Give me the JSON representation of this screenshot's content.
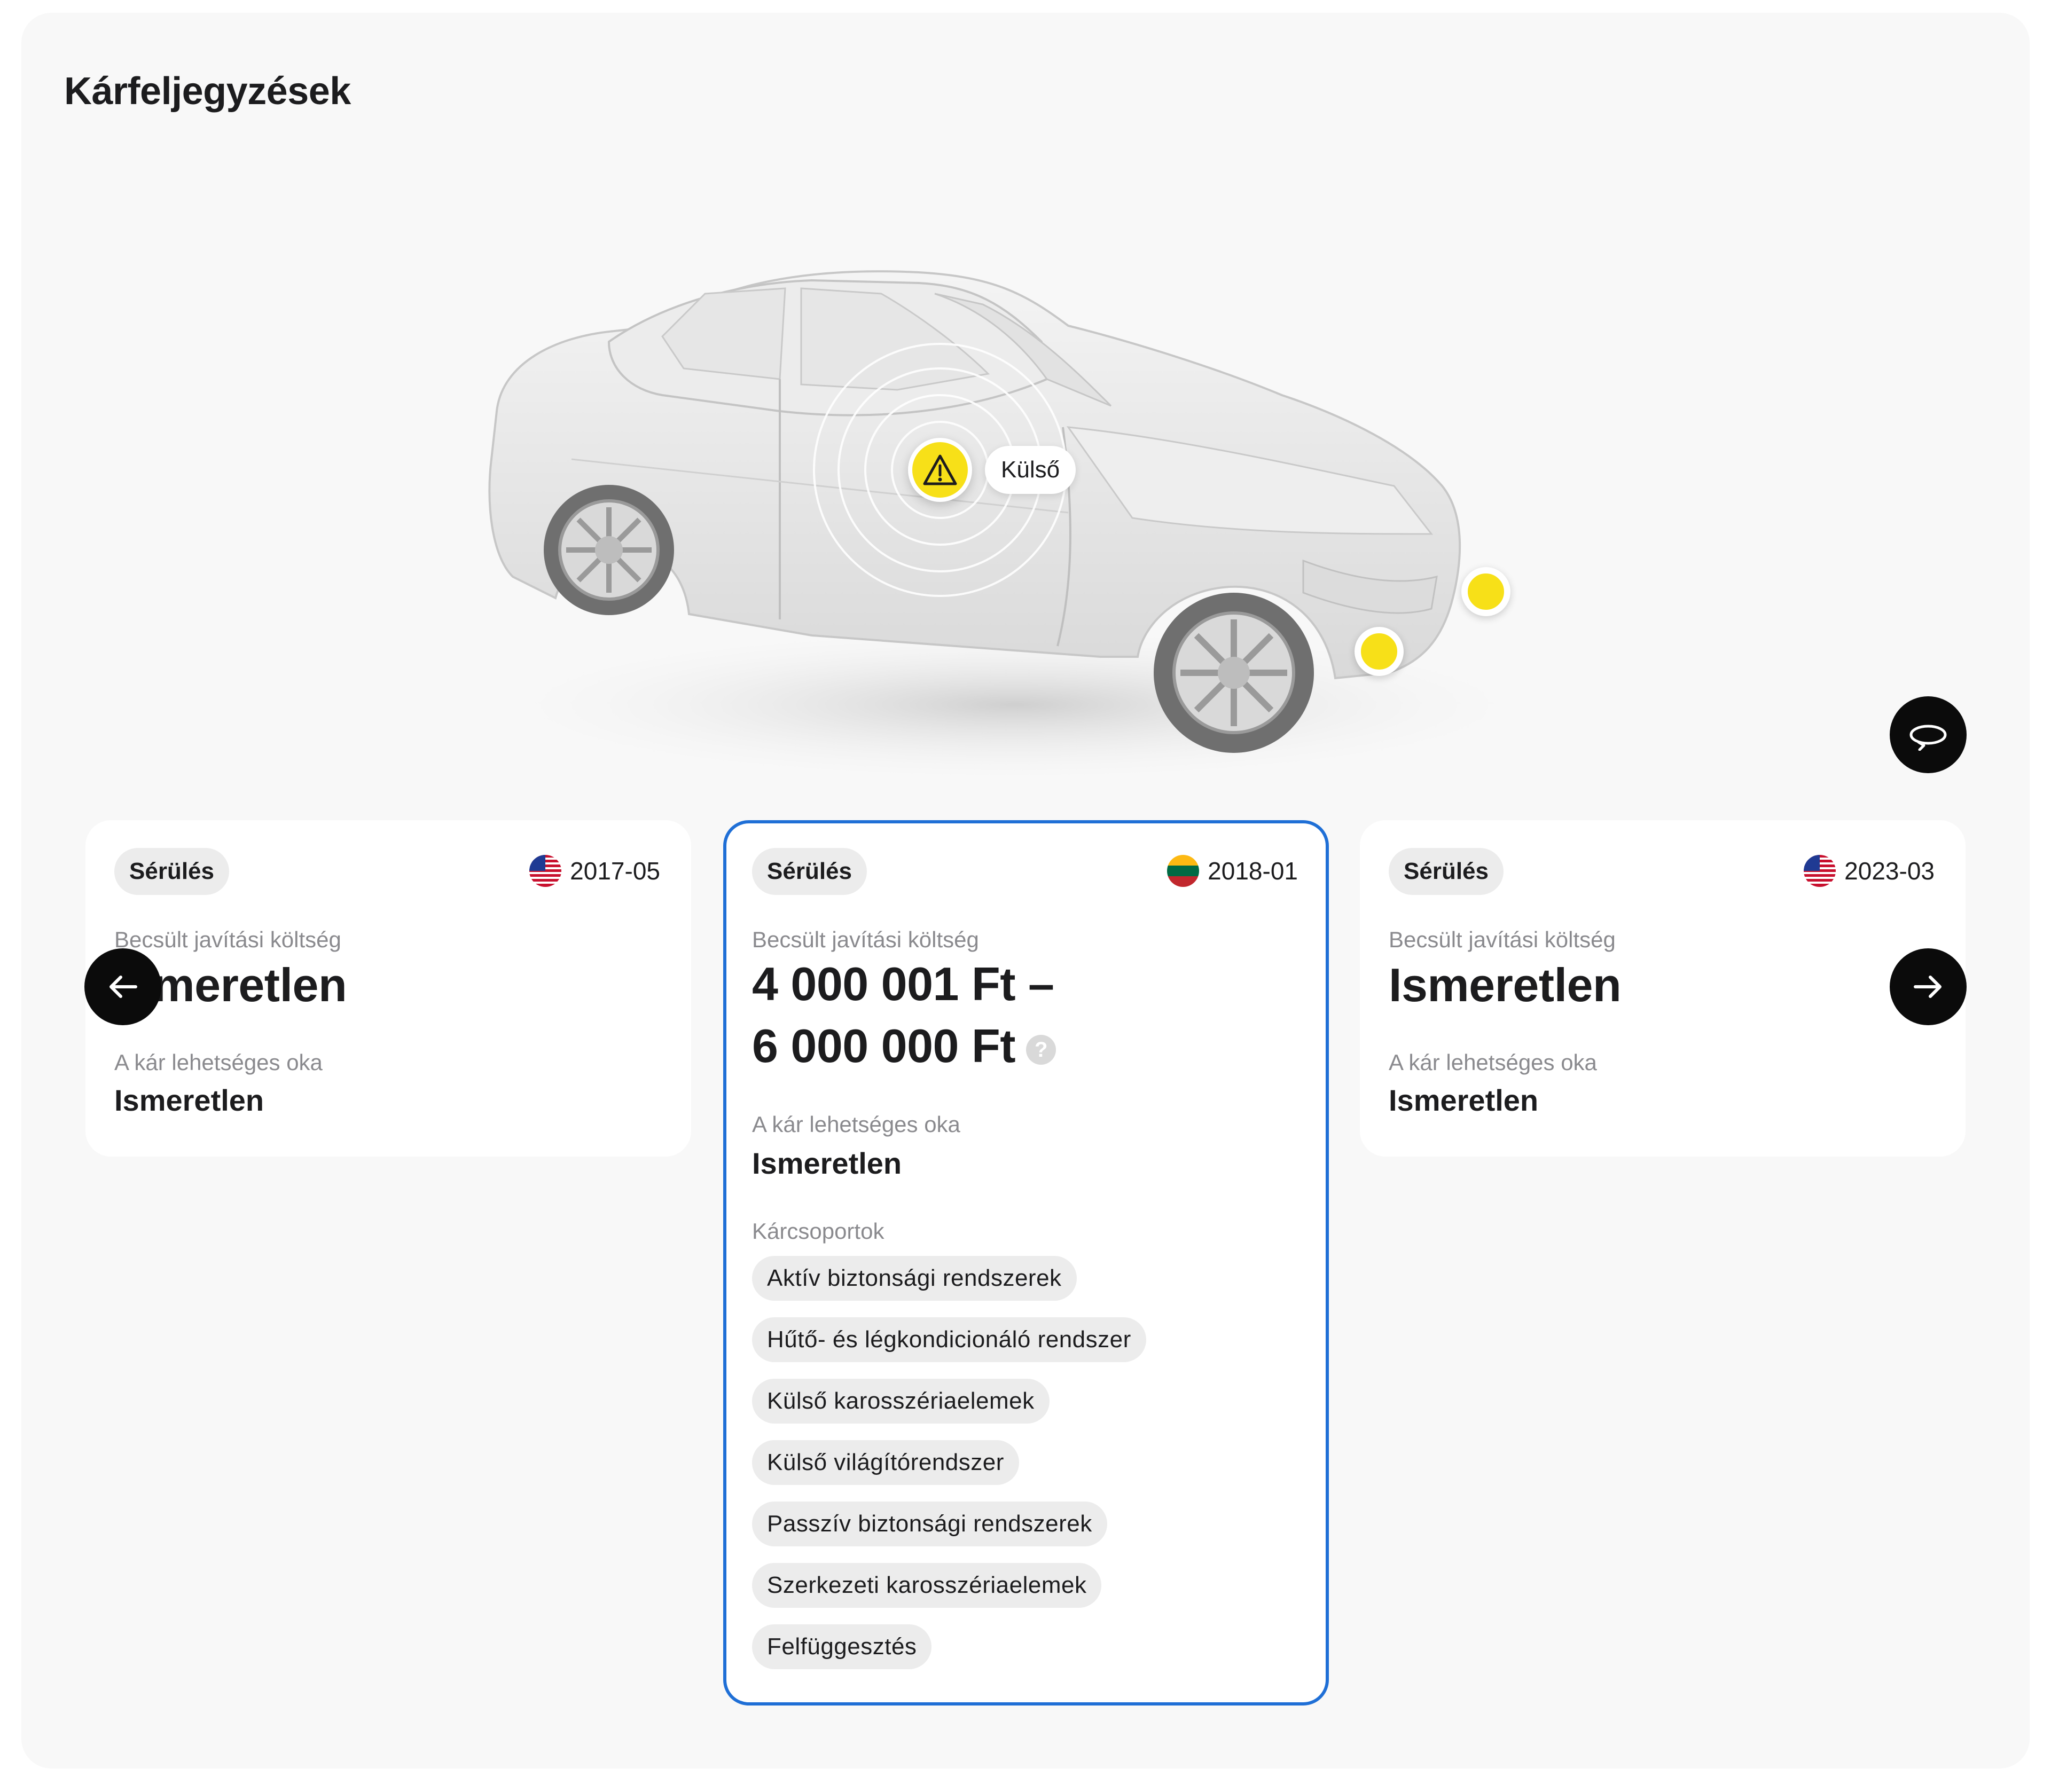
{
  "page": {
    "title": "Kárfeljegyzések"
  },
  "viewer": {
    "marker_label": "Külső",
    "rotate_icon": "rotate-icon"
  },
  "navigation": {
    "prev_icon": "arrow-left-icon",
    "next_icon": "arrow-right-icon"
  },
  "cards": [
    {
      "badge": "Sérülés",
      "date": "2017-05",
      "flag": "us-flag-icon",
      "cost_label": "Becsült javítási költség",
      "cost_value": "Ismeretlen",
      "cause_label": "A kár lehetséges oka",
      "cause_value": "Ismeretlen"
    },
    {
      "badge": "Sérülés",
      "date": "2018-01",
      "flag": "lt-flag-icon",
      "cost_label": "Becsült javítási költség",
      "cost_line1": "4 000 001 Ft –",
      "cost_line2": "6 000 000 Ft",
      "help_glyph": "?",
      "cause_label": "A kár lehetséges oka",
      "cause_value": "Ismeretlen",
      "groups_label": "Kárcsoportok",
      "groups": [
        "Aktív biztonsági rendszerek",
        "Hűtő- és légkondicionáló rendszer",
        "Külső karosszériaelemek",
        "Külső világítórendszer",
        "Passzív biztonsági rendszerek",
        "Szerkezeti karosszériaelemek",
        "Felfüggesztés"
      ]
    },
    {
      "badge": "Sérülés",
      "date": "2023-03",
      "flag": "us-flag-icon",
      "cost_label": "Becsült javítási költség",
      "cost_value": "Ismeretlen",
      "cause_label": "A kár lehetséges oka",
      "cause_value": "Ismeretlen"
    }
  ],
  "colors": {
    "accent": "#1f6fd6",
    "marker": "#f7e018",
    "button": "#0b0b0b"
  }
}
